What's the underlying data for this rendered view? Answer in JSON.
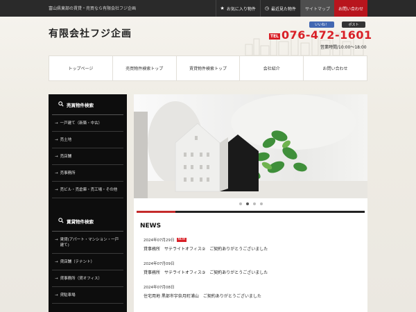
{
  "topbar": {
    "tagline": "富山県東部の賃貸・売買なら有限会社フジ企画",
    "links": [
      {
        "label": "お気に入り物件",
        "icon": "star-icon"
      },
      {
        "label": "最近見た物件",
        "icon": "history-icon"
      },
      {
        "label": "サイトマップ"
      },
      {
        "label": "お問い合わせ"
      }
    ]
  },
  "header": {
    "logo": "有限会社フジ企画",
    "fb_like": "いいね！",
    "x_post": "ポスト",
    "tel_badge": "TEL",
    "tel": "076-472-1601",
    "hours": "営業時間/10:00～18:00"
  },
  "nav": {
    "items": [
      "トップページ",
      "売買物件検索トップ",
      "賃貸物件検索トップ",
      "会社紹介",
      "お問い合わせ"
    ]
  },
  "sidebar": {
    "section1": {
      "title": "売買物件検索",
      "items": [
        "一戸建て（新築・中古）",
        "売土地",
        "売店舗",
        "売事務所",
        "売ビル・売倉庫・売工場・その他"
      ]
    },
    "section2": {
      "title": "賃貸物件検索",
      "items": [
        "賃貸(アパート・マンション・一戸建て)",
        "貸店舗（テナント）",
        "貸事務所（貸オフィス）",
        "貸駐車場"
      ]
    }
  },
  "slider": {
    "dots": 4,
    "active_index": 1,
    "progress": 0.17
  },
  "news": {
    "title": "NEWS",
    "new_badge": "NEW",
    "items": [
      {
        "date": "2024年07月29日",
        "is_new": true,
        "text": "貸事務所　サテライトオフィス②　ご契約ありがとうございました"
      },
      {
        "date": "2024年07月09日",
        "is_new": false,
        "text": "貸事務所　サテライトオフィス③　ご契約ありがとうございました"
      },
      {
        "date": "2024年07月08日",
        "is_new": false,
        "text": "住宅用地 黒部市宇奈月町浦山　ご契約ありがとうございました"
      }
    ]
  },
  "colors": {
    "accent_red": "#d92027",
    "topbar_bg": "#2a2a2a",
    "sidebar_bg": "#0d0d0d"
  }
}
